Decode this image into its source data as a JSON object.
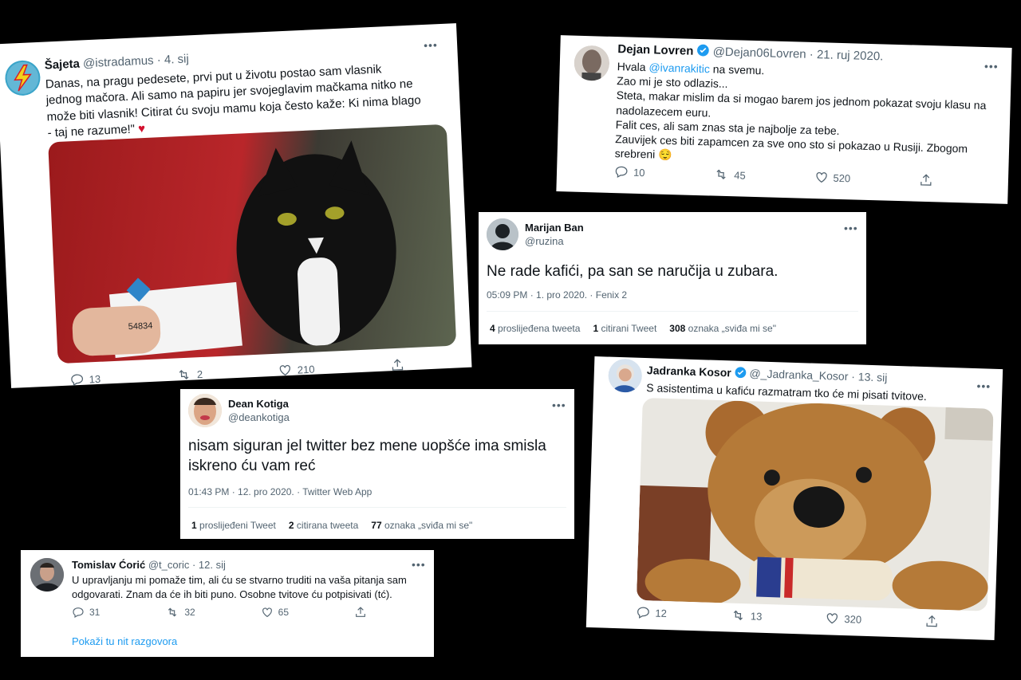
{
  "tweets": {
    "sajeta": {
      "name": "Šajeta",
      "handle": "@istradamus",
      "date": "· 4. sij",
      "text": "Danas, na pragu pedesete, prvi put u životu postao sam vlasnik jednog mačora. Ali samo na papiru jer svojeglavim mačkama nitko ne može biti vlasnik! Citirat ću svoju mamu koja često kaže: Ki nima blago - taj ne razume!\"",
      "emoji": "♥",
      "card_number": "54834",
      "replies": "13",
      "retweets": "2",
      "likes": "210"
    },
    "lovren": {
      "name": "Dejan Lovren",
      "handle": "@Dejan06Lovren",
      "date": "· 21. ruj 2020.",
      "line1_prefix": "Hvala ",
      "line1_mention": "@ivanrakitic",
      "line1_suffix": " na svemu.",
      "line2": "Zao mi je sto odlazis...",
      "line3": "Steta, makar mislim da si mogao barem jos jednom pokazat svoju klasu na nadolazecem euru.",
      "line4": "Falit ces, ali sam znas sta je najbolje za tebe.",
      "line5": "Zauvijek ces biti zapamcen za sve ono sto si pokazao u Rusiji. Zbogom srebreni",
      "emoji": "😌",
      "replies": "10",
      "retweets": "45",
      "likes": "520"
    },
    "ban": {
      "name": "Marijan Ban",
      "handle": "@ruzina",
      "text": "Ne rade kafići, pa san se naručija u zubara.",
      "meta": "05:09 PM · 1. pro 2020. · Fenix 2",
      "retweets_n": "4",
      "retweets_label": "proslijeđena tweeta",
      "quotes_n": "1",
      "quotes_label": "citirani Tweet",
      "likes_n": "308",
      "likes_label": "oznaka „sviđa mi se\""
    },
    "kotiga": {
      "name": "Dean Kotiga",
      "handle": "@deankotiga",
      "text": "nisam siguran jel twitter bez mene uopšće ima smisla iskreno ću vam reć",
      "meta": "01:43 PM · 12. pro 2020. · Twitter Web App",
      "retweets_n": "1",
      "retweets_label": "proslijeđeni Tweet",
      "quotes_n": "2",
      "quotes_label": "citirana tweeta",
      "likes_n": "77",
      "likes_label": "oznaka „sviđa mi se\""
    },
    "kosor": {
      "name": "Jadranka Kosor",
      "handle": "@_Jadranka_Kosor",
      "date": "· 13. sij",
      "text": "S asistentima u kafiću razmatram tko će mi pisati tvitove.",
      "replies": "12",
      "retweets": "13",
      "likes": "320"
    },
    "coric": {
      "name": "Tomislav Ćorić",
      "handle": "@t_coric",
      "date": "· 12. sij",
      "text": "U upravljanju mi pomaže tim, ali ću se stvarno truditi na vaša pitanja sam odgovarati. Znam da će ih biti puno. Osobne tvitove ću potpisivati (tć).",
      "replies": "31",
      "retweets": "32",
      "likes": "65",
      "thread_link": "Pokaži tu nit razgovora"
    }
  },
  "more_glyph": "•••",
  "colors": {
    "link": "#1d9bf0",
    "secondary": "#536471",
    "background": "#000000"
  }
}
